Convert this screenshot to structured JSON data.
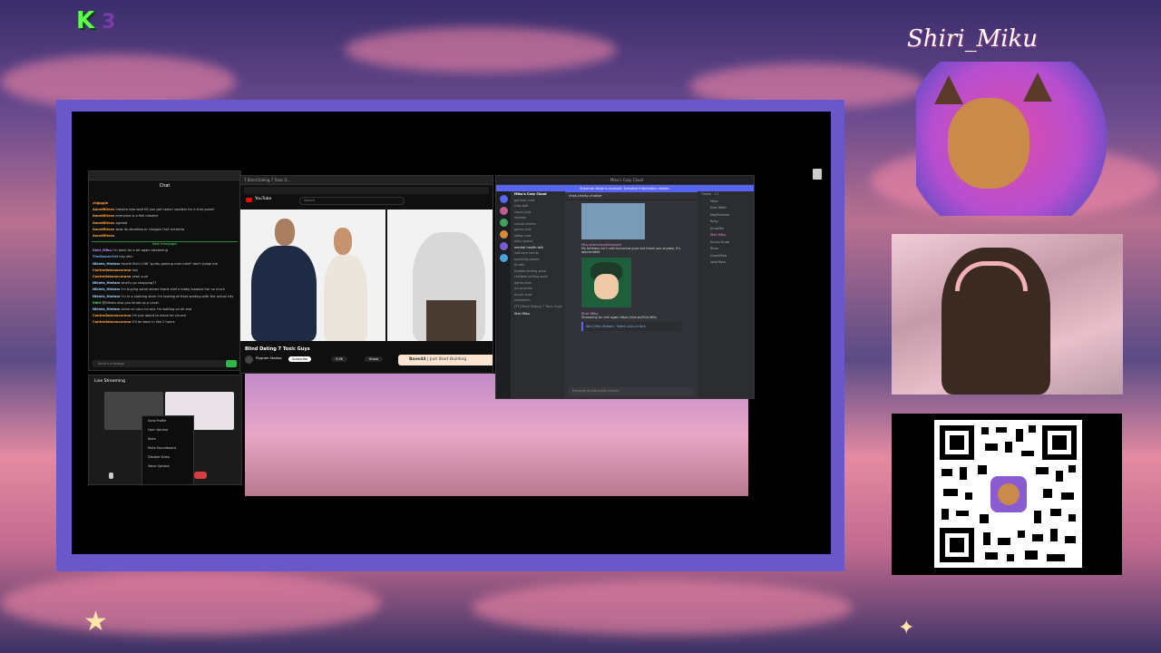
{
  "overlay": {
    "logo_letter": "K",
    "logo_number": "3",
    "brand_name": "Shiri_Miku"
  },
  "chat": {
    "window_title": "Chat",
    "new_messages_label": "New messages",
    "messages": [
      {
        "name": "cilgiggle",
        "text": ""
      },
      {
        "name": "AmedRitexx",
        "text": "hahaha toto wait till you get home! spoilers for a true panel!"
      },
      {
        "name": "AmedRitexx",
        "text": "everyone is a fish masterr"
      },
      {
        "name": "AmedRitexx",
        "text": "agreed"
      },
      {
        "name": "AmedRitexx",
        "text": "wow its stonetoo or chagpin fruit melocha"
      },
      {
        "name": "AmedRitexx",
        "text": ""
      },
      {
        "name": "Shiri_Miku",
        "text": "I'm back for a bit again streaming"
      },
      {
        "name": "TheGamerCrit",
        "text": "hey shiri"
      },
      {
        "name": "Nikiels_Hintam",
        "text": "Hustle Shiri LOW \"guilty gaming mali cubit\" don't judge me"
      },
      {
        "name": "Cantrallabonocorona",
        "text": "hey"
      },
      {
        "name": "Cantrallabonocorona",
        "text": "yeah sure"
      },
      {
        "name": "Nikiels_Hintam",
        "text": "what's up shopping??"
      },
      {
        "name": "Nikiels_Hintam",
        "text": "i'm buying some stores thank shiri's lobby loooove her so much"
      },
      {
        "name": "Nikiels_Hintam",
        "text": "i'm in a clothing store i'm looking at fixes waiting with the actual city"
      },
      {
        "name": "Shiri",
        "text": "@Nikiels also you kinda up a Level"
      },
      {
        "name": "Nikiels_Hintam",
        "text": "come on your no one i'm waiting on all and"
      },
      {
        "name": "Cantrallabonocorona",
        "text": "I'm just about to leave for church"
      },
      {
        "name": "Cantrallabonocorona",
        "text": "it'll be back in like 2 hours"
      }
    ],
    "input_placeholder": "Send a message"
  },
  "youtube": {
    "tab_title": "7 Blind Dating 7 Toxic G...",
    "brand": "YouTube",
    "search_placeholder": "Search",
    "video_title": "Blind Dating 7 Toxic Guys",
    "channel": "Plygram Studios",
    "subscribe_label": "Subscribe",
    "likes": "5.9K",
    "share_label": "Share",
    "ad_brand": "Base44",
    "ad_text": "Just Start Building"
  },
  "discord": {
    "window_title": "Miku's Cozy Cloud",
    "banner": "Streamer Mode is enabled. Sensitive Information hidden.",
    "server_name": "Miku's Cozy Cloud",
    "channel_header": "chat-chatty-chatter",
    "channels": [
      "general-chat",
      "chat-talk",
      "cloud-chat",
      "memes",
      "sunset-meets",
      "game-chat",
      "lobby-chat",
      "daily-queue",
      "mental health talk",
      "self-care corner",
      "positivity-board",
      "fit-talk",
      "bubble-writing-zone",
      "rainbow-writing-zone",
      "game-chat",
      "art-and-tea",
      "music-chat",
      "streamers",
      "[YT] Blind Dating 7 Toxic Guys"
    ],
    "messages": [
      {
        "author": "MisunderstoodAssassin",
        "text": "My birthday isn't until tomorrow guys but thank you anyway. It's appreciated"
      },
      {
        "author": "Shiri Miku",
        "text": "Streaming for chill again https://link.to/Shiri-Miku"
      }
    ],
    "live_card": "Shiri_Miku Stream - Twitch Live on Kick",
    "message_placeholder": "Message #chat-chatty-chatter",
    "members_header": "Online - 11",
    "members": [
      "Mina",
      "Elsa Taffer",
      "Mayfleelove",
      "Ruby",
      "SnowTee",
      "Shiri Miku",
      "Sunny Knob",
      "Shoe",
      "CharliMaw",
      "xoxoTraxx"
    ],
    "user_name": "Shiri Miku"
  },
  "streaming": {
    "title": "Live Streaming",
    "menu_items": [
      "View Profile",
      "User Volume",
      "Mute",
      "Mute Soundboard",
      "Disable Video",
      "Voice Options"
    ]
  }
}
